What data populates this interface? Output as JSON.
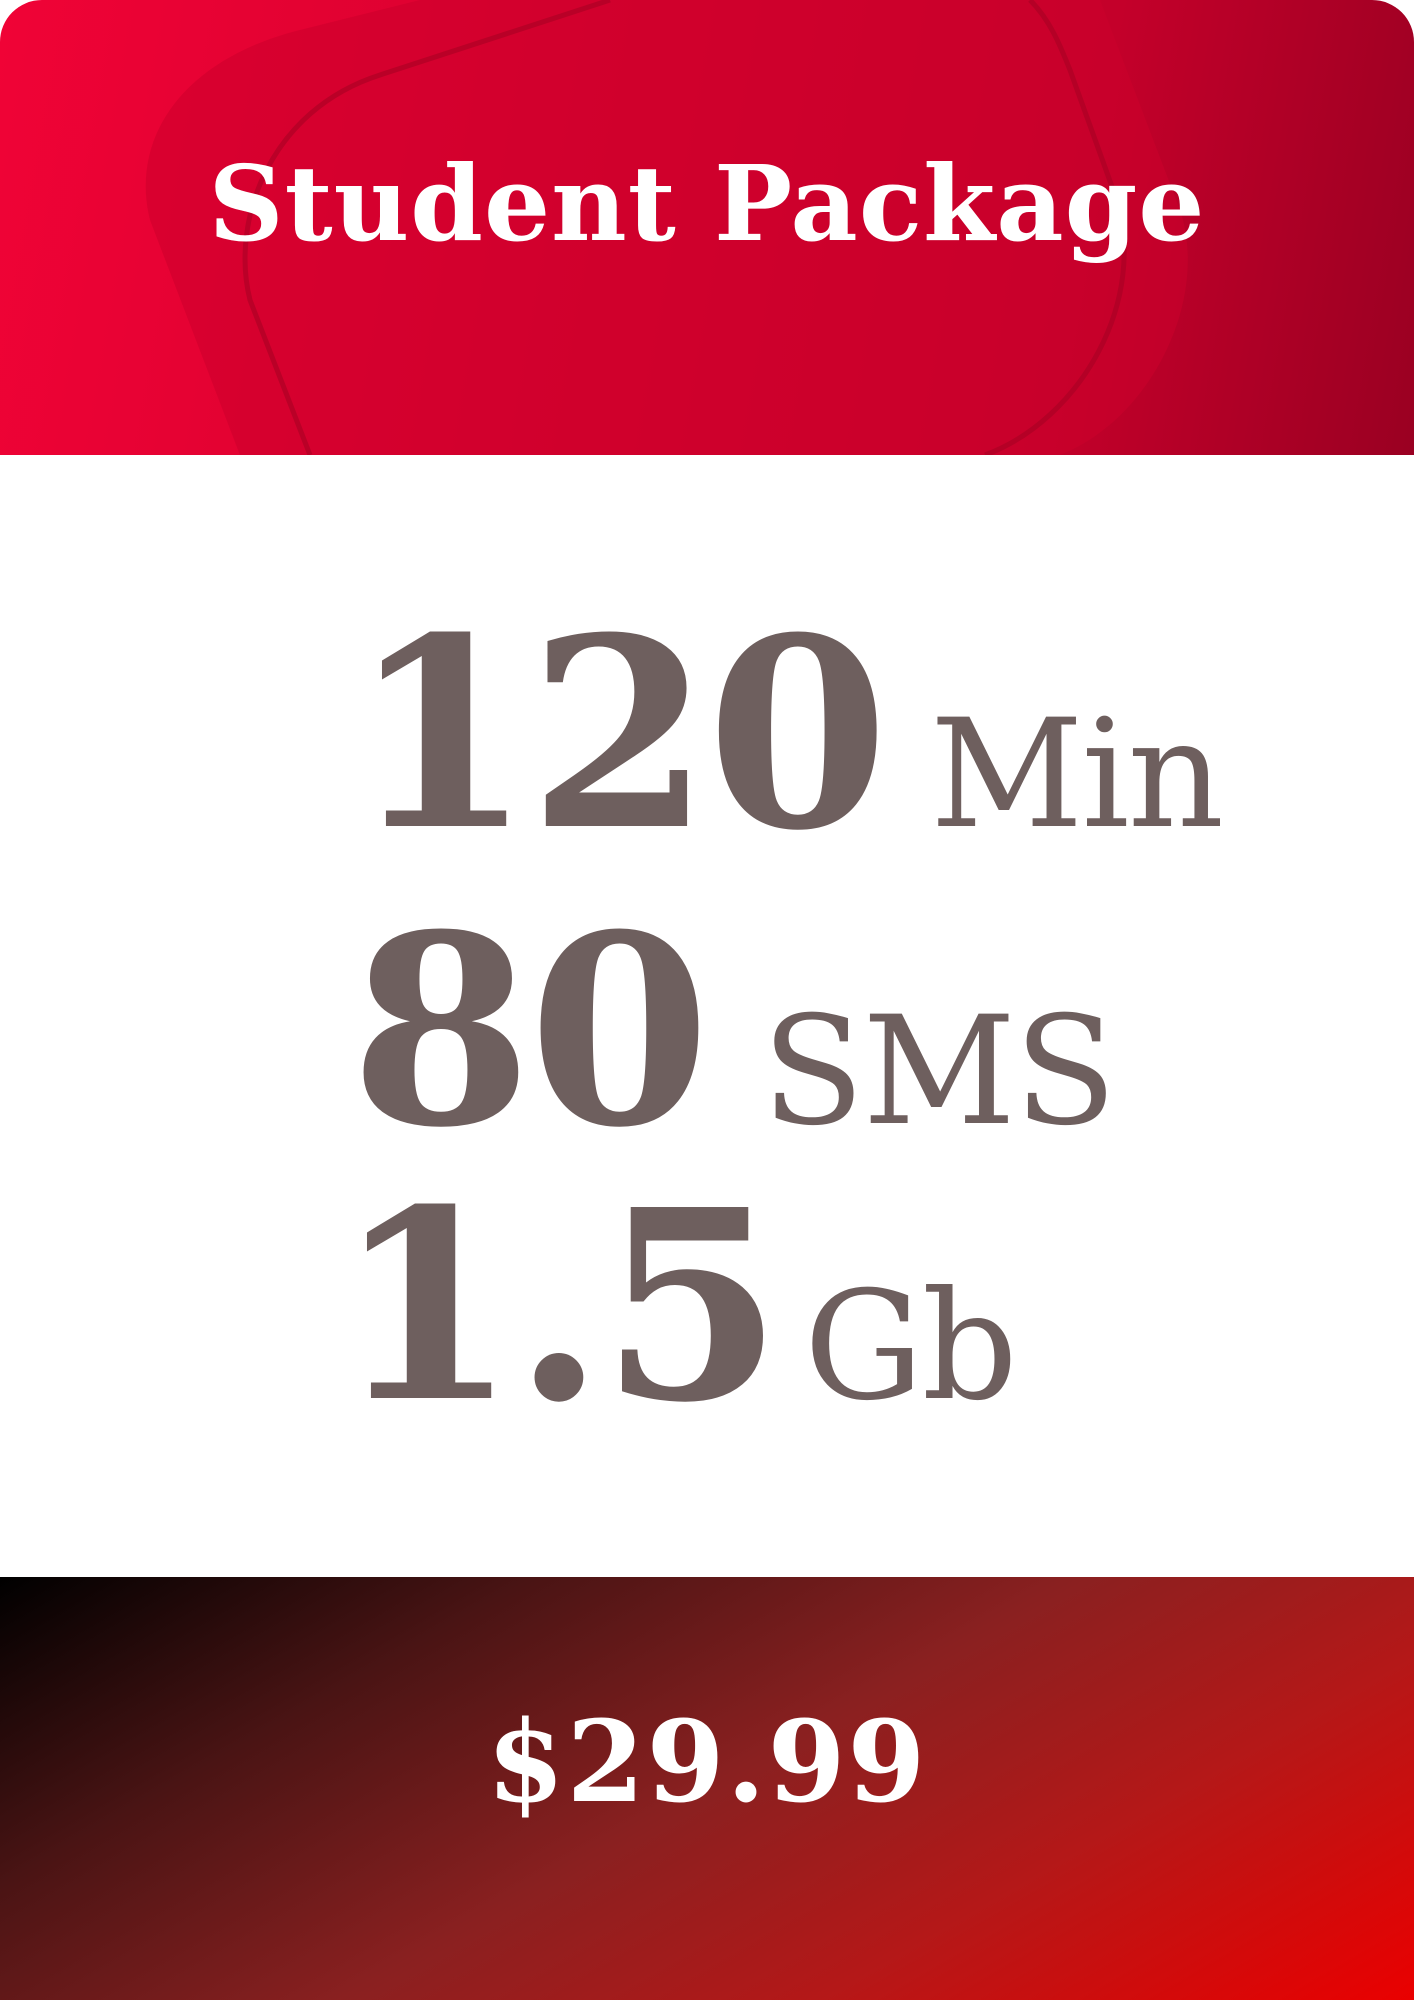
{
  "header": {
    "title": "Student Package"
  },
  "features": {
    "minutes": {
      "value": "120",
      "unit": "Min"
    },
    "sms": {
      "value": "80",
      "unit": "SMS"
    },
    "data": {
      "value": "1.5",
      "unit": "Gb"
    }
  },
  "price": {
    "label": "$29.99"
  },
  "colors": {
    "header_red": "#d5002e",
    "text_grey": "#6e5f5e",
    "band_dark": "#000000",
    "band_red": "#ea0000"
  }
}
